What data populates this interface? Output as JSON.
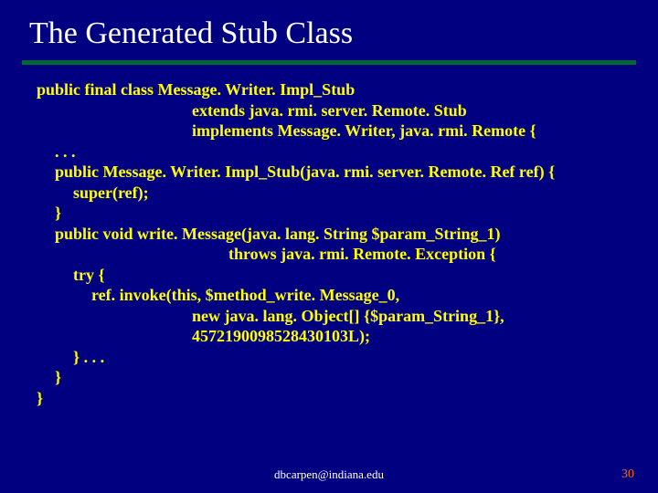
{
  "title": "The Generated Stub Class",
  "code": {
    "l1": "public final class Message. Writer. Impl_Stub",
    "l2": "extends java. rmi. server. Remote. Stub",
    "l3": "implements Message. Writer, java. rmi. Remote {",
    "l4": ". . .",
    "l5": "public Message. Writer. Impl_Stub(java. rmi. server. Remote. Ref ref) {",
    "l6": "super(ref);",
    "l7": "}",
    "l8": "public void write. Message(java. lang. String $param_String_1)",
    "l9": "throws java. rmi. Remote. Exception {",
    "l10": "try {",
    "l11": "ref. invoke(this, $method_write. Message_0,",
    "l12": "new java. lang. Object[] {$param_String_1},",
    "l13": "4572190098528430103L);",
    "l14": "} . . .",
    "l15": "}",
    "l16": "}"
  },
  "footer": {
    "email": "dbcarpen@indiana.edu",
    "page": "30"
  }
}
